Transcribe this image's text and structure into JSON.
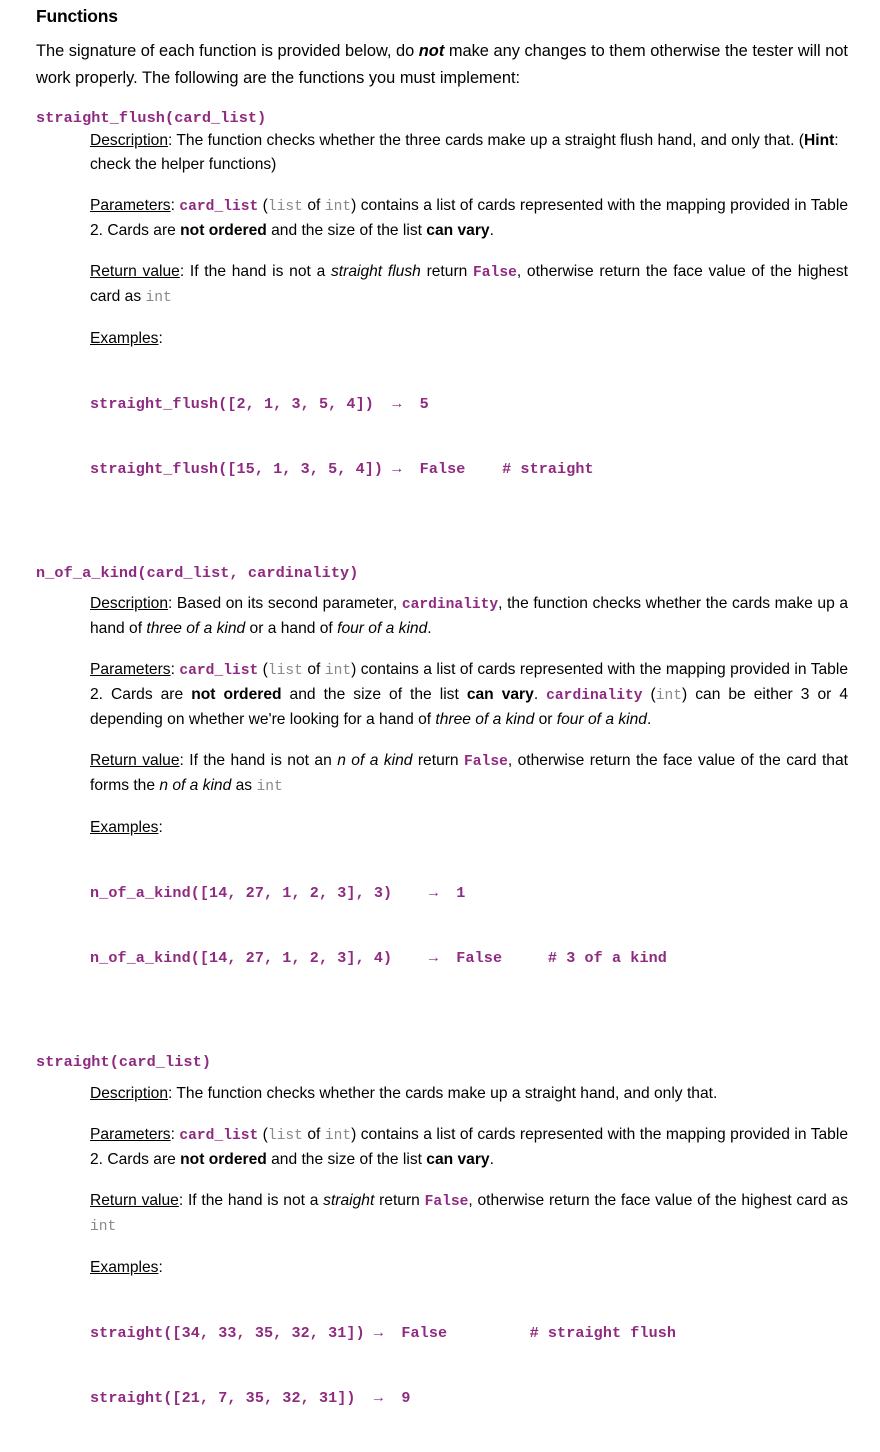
{
  "document": {
    "heading": "Functions",
    "intro": {
      "part1": "The signature of each function is provided below, do ",
      "emphasis": "not",
      "part2": " make any changes to them otherwise the tester will not work properly. The following are the functions you must implement:"
    },
    "labels": {
      "description": "Description",
      "parameters": "Parameters",
      "return_value": "Return value",
      "examples": "Examples",
      "colon": ":",
      "hint": "Hint",
      "arrow": "→"
    },
    "common": {
      "card_list": "card_list",
      "cardinality": "cardinality",
      "type_list": "list",
      "type_int": "int",
      "of": " of ",
      "false": "False",
      "params_lead": " (",
      "params_close": ") contains a list of cards represented with the mapping provided in Table 2. Cards are ",
      "not_ordered": "not ordered",
      "and_size": " and the size of the list ",
      "can_vary": "can vary",
      "period": "."
    },
    "functions": [
      {
        "id": "straight_flush",
        "signature": "straight_flush(card_list)",
        "description": {
          "line1_pre": ": The function checks whether the three cards make up a straight flush hand, and only that. (",
          "hint_label": "Hint",
          "line1_post": ": check the helper functions)"
        },
        "parameters": {
          "tail": ""
        },
        "return_value": {
          "pre": ": If the hand is not a ",
          "italic": "straight flush",
          "mid": " return ",
          "value": "False",
          "post": ", otherwise return the face value of the highest card as ",
          "type": "int"
        },
        "examples": [
          {
            "call": "straight_flush([2, 1, 3, 5, 4])",
            "arrow": "→",
            "result": "5",
            "comment": ""
          },
          {
            "call": "straight_flush([15, 1, 3, 5, 4])",
            "arrow": "→",
            "result": "False",
            "comment": "# straight"
          }
        ],
        "example_columns": {
          "call_width": 33,
          "result_width": 9
        }
      },
      {
        "id": "n_of_a_kind",
        "signature": "n_of_a_kind(card_list, cardinality)",
        "description": {
          "pre": ": Based on its second parameter, ",
          "code": "cardinality",
          "mid": ", the function checks whether the cards make up a hand of ",
          "italic1": "three of a kind",
          "mid2": " or a hand of ",
          "italic2": "four of a kind",
          "post": "."
        },
        "parameters": {
          "tail_pre": ". ",
          "tail_code": "cardinality",
          "tail_type_open": " (",
          "tail_type": "int",
          "tail_type_close": ") can be either 3 or 4 depending on whether we're looking for a hand of ",
          "tail_italic1": "three of a kind",
          "tail_mid": " or ",
          "tail_italic2": "four of a kind",
          "tail_end": "."
        },
        "return_value": {
          "pre": ": If the hand is not an ",
          "italic": "n of a kind",
          "mid": " return ",
          "value": "False",
          "post": ", otherwise return the face value of the card that forms the ",
          "italic2": "n of a kind",
          "post2": " as ",
          "type": "int"
        },
        "examples": [
          {
            "call": "n_of_a_kind([14, 27, 1, 2, 3], 3)",
            "arrow": "→",
            "result": "1",
            "comment": ""
          },
          {
            "call": "n_of_a_kind([14, 27, 1, 2, 3], 4)",
            "arrow": "→",
            "result": "False",
            "comment": "# 3 of a kind"
          }
        ],
        "example_columns": {
          "call_width": 37,
          "result_width": 10
        }
      },
      {
        "id": "straight",
        "signature": "straight(card_list)",
        "description": {
          "line1_pre": ": The function checks whether the cards make up a straight hand, and only that."
        },
        "parameters": {
          "tail": ""
        },
        "return_value": {
          "pre": ": If the hand is not a ",
          "italic": "straight",
          "mid": " return ",
          "value": "False",
          "post": ", otherwise return the face value of the highest card as ",
          "type": "int"
        },
        "examples": [
          {
            "call": "straight([34, 33, 35, 32, 31])",
            "arrow": "→",
            "result": "False",
            "comment": "# straight flush"
          },
          {
            "call": "straight([21, 7, 35, 32, 31])",
            "arrow": "→",
            "result": "9",
            "comment": ""
          }
        ],
        "example_columns": {
          "call_width": 31,
          "result_width": 14
        }
      }
    ],
    "colors": {
      "code_purple": "#8f2a80",
      "type_gray": "#8a8a8a",
      "text_black": "#000000",
      "background": "#ffffff"
    }
  }
}
